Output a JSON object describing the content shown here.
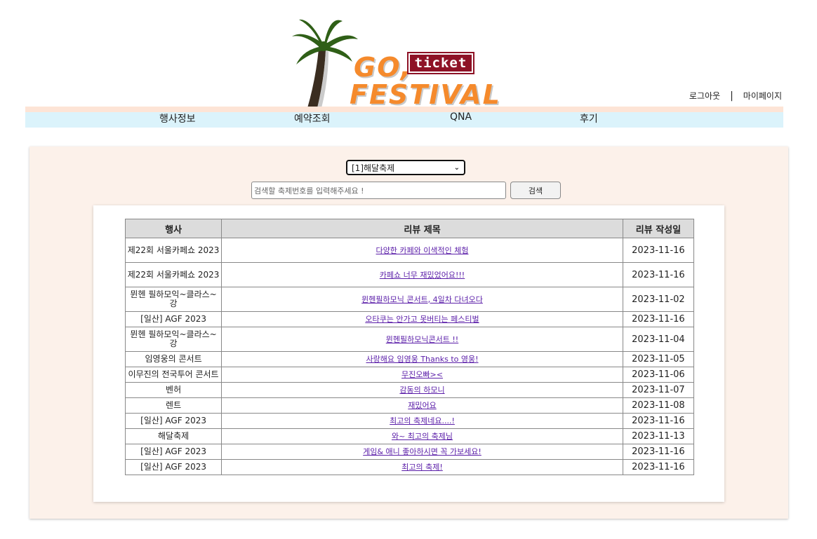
{
  "brand": {
    "line1": "GO,",
    "ticket": "ticket",
    "line2": "FESTIVAL"
  },
  "user_links": {
    "logout": "로그아웃",
    "separator": "|",
    "mypage": "마이페이지"
  },
  "nav": [
    "행사정보",
    "예약조회",
    "QNA",
    "후기"
  ],
  "filter": {
    "selected": "[1]해달축제",
    "search_placeholder": "검색할 축제번호를 입력해주세요 !",
    "search_button": "검색"
  },
  "table": {
    "headers": [
      "행사",
      "리뷰 제목",
      "리뷰 작성일"
    ],
    "rows": [
      {
        "event": "제22회 서울카페쇼 2023",
        "title": "다양한 카페와 이색적인 체험",
        "date": "2023-11-16"
      },
      {
        "event": "제22회 서울카페쇼 2023",
        "title": "카페쇼 너무 재밌었어요!!!",
        "date": "2023-11-16"
      },
      {
        "event": "뮌헨 필하모익~클라스~ 강",
        "title": "뮌헨필하모닉 콘서트, 4일차 다녀오다",
        "date": "2023-11-02"
      },
      {
        "event": "[일산] AGF 2023",
        "title": "오타쿠는 안가고 못버티는 페스티벌",
        "date": "2023-11-16"
      },
      {
        "event": "뮌헨 필하모익~클라스~ 강",
        "title": "뮌헨필하모닉콘서트 !!",
        "date": "2023-11-04"
      },
      {
        "event": "임영웅의 콘서트",
        "title": "사랑해요 임영웅 Thanks to 영웅!",
        "date": "2023-11-05"
      },
      {
        "event": "이무진의 전국투어 콘서트",
        "title": "무진오빠><",
        "date": "2023-11-06"
      },
      {
        "event": "벤허",
        "title": "감동의 하모니",
        "date": "2023-11-07"
      },
      {
        "event": "렌트",
        "title": "재밌어요",
        "date": "2023-11-08"
      },
      {
        "event": "[일산] AGF 2023",
        "title": "최고의 축제네요....!",
        "date": "2023-11-16"
      },
      {
        "event": "해달축제",
        "title": "와~ 최고의 축제님",
        "date": "2023-11-13"
      },
      {
        "event": "[일산] AGF 2023",
        "title": "게임& 애니 좋아하시면 꼭 가보세요!",
        "date": "2023-11-16"
      },
      {
        "event": "[일산] AGF 2023",
        "title": "최고의 축제!",
        "date": "2023-11-16"
      }
    ]
  }
}
